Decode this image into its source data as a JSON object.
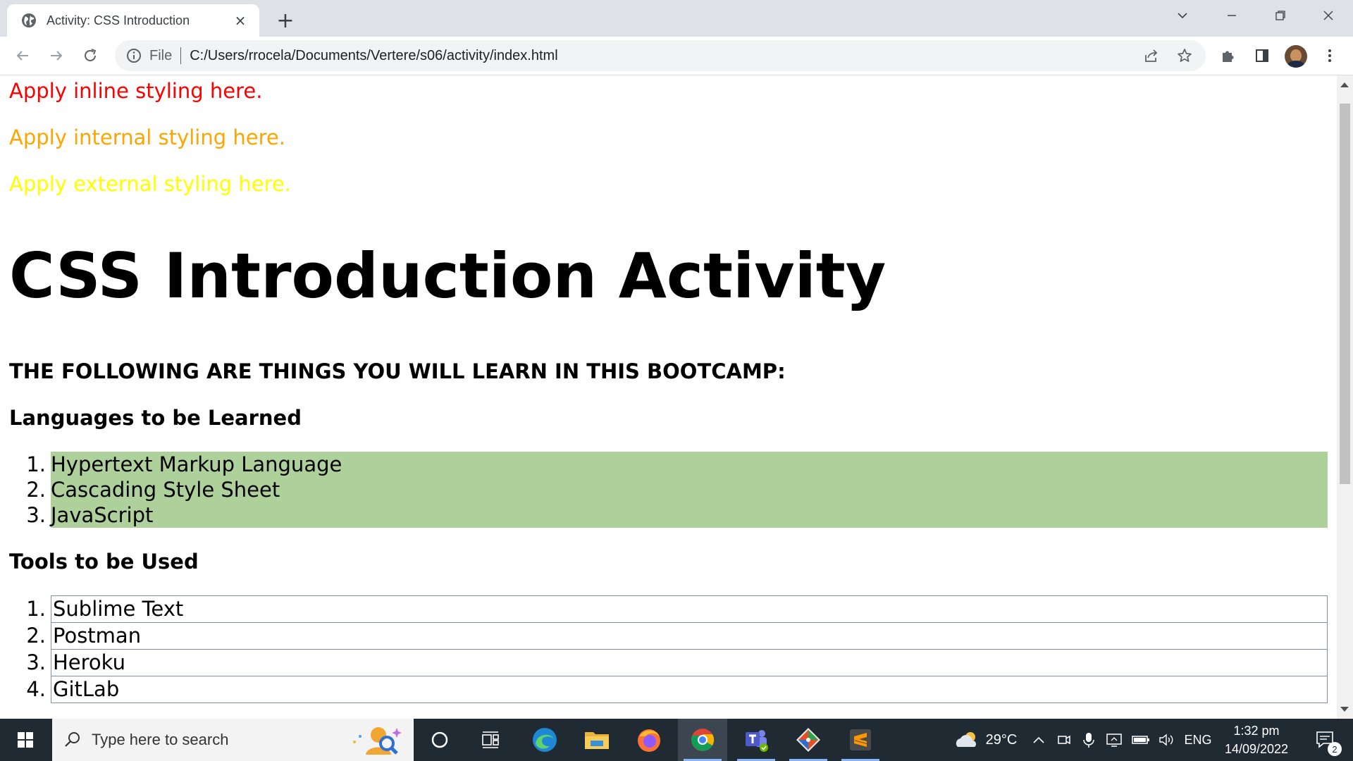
{
  "browser": {
    "tab": {
      "title": "Activity: CSS Introduction",
      "favicon": "globe-icon",
      "close": "×"
    },
    "new_tab": "+",
    "address": {
      "scheme": "File",
      "url": "C:/Users/rrocela/Documents/Vertere/s06/activity/index.html"
    }
  },
  "page": {
    "inline_text": "Apply inline styling here.",
    "internal_text": "Apply internal styling here.",
    "external_text": "Apply external styling here.",
    "heading": "CSS Introduction Activity",
    "subheading": "THE FOLLOWING ARE THINGS YOU WILL LEARN IN THIS BOOTCAMP:",
    "languages": {
      "title": "Languages to be Learned",
      "items": [
        {
          "num": "1.",
          "text": "Hypertext Markup Language"
        },
        {
          "num": "2.",
          "text": "Cascading Style Sheet"
        },
        {
          "num": "3.",
          "text": "JavaScript"
        }
      ]
    },
    "tools": {
      "title": "Tools to be Used",
      "items": [
        {
          "num": "1.",
          "text": "Sublime Text"
        },
        {
          "num": "2.",
          "text": "Postman"
        },
        {
          "num": "3.",
          "text": "Heroku"
        },
        {
          "num": "4.",
          "text": "GitLab"
        }
      ]
    },
    "colors": {
      "inline": "#ff0000",
      "internal": "#ffa500",
      "external": "#ffff00",
      "languages_bg": "#aed19b"
    }
  },
  "taskbar": {
    "search_placeholder": "Type here to search",
    "weather": "29°C",
    "language": "ENG",
    "time": "1:32 pm",
    "date": "14/09/2022",
    "notifications": "2",
    "apps": [
      "start-icon",
      "cortana-icon",
      "task-view-icon",
      "edge-icon",
      "file-explorer-icon",
      "firefox-icon",
      "chrome-icon",
      "teams-icon",
      "git-icon",
      "sublime-icon"
    ]
  }
}
